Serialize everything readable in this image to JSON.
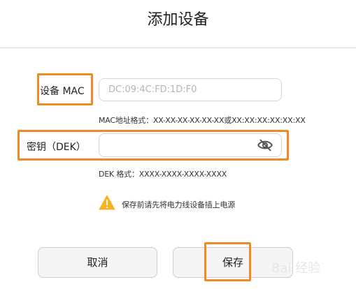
{
  "title": "添加设备",
  "mac": {
    "label": "设备 MAC",
    "value": "DC:09:4C:FD:1D:F0",
    "hint": "MAC地址格式：XX-XX-XX-XX-XX-XX或XX:XX:XX:XX:XX:XX"
  },
  "dek": {
    "label": "密钥（DEK）",
    "value": "",
    "hint": "DEK 格式：XXXX-XXXX-XXXX-XXXX",
    "toggle_icon": "eye-off-icon"
  },
  "warning": {
    "icon": "warning-icon",
    "text": "保存前请先将电力线设备插上电源"
  },
  "buttons": {
    "cancel": "取消",
    "save": "保存"
  },
  "watermark": "Bai 经验",
  "colors": {
    "highlight": "#f08a24",
    "warning": "#f5b323"
  }
}
